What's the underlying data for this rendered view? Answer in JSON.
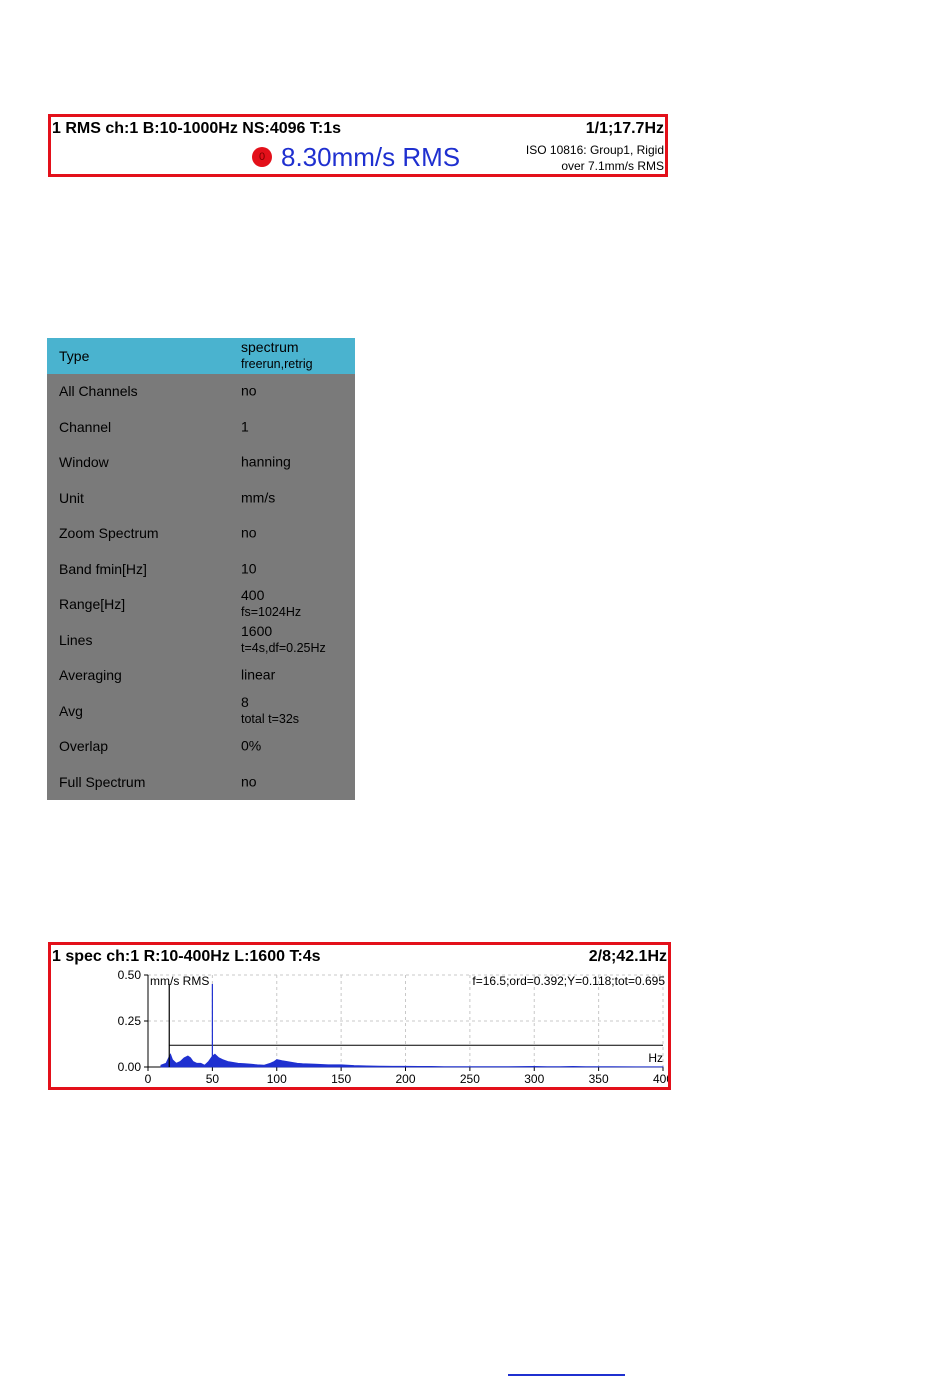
{
  "rms": {
    "title": "1 RMS ch:1 B:10-1000Hz NS:4096 T:1s",
    "position": "1/1;17.7Hz",
    "led_label": "0",
    "value": "8.30mm/s RMS",
    "iso_line1": "ISO 10816: Group1, Rigid",
    "iso_line2": "over 7.1mm/s RMS",
    "colors": {
      "border": "#e3101a",
      "value": "#1f30d0",
      "led": "#e3101a"
    }
  },
  "settings": {
    "rows": [
      {
        "label": "Type",
        "value": "spectrum",
        "sub": "freerun,retrig",
        "selected": true
      },
      {
        "label": "All Channels",
        "value": "no",
        "sub": ""
      },
      {
        "label": "Channel",
        "value": "1",
        "sub": ""
      },
      {
        "label": "Window",
        "value": "hanning",
        "sub": ""
      },
      {
        "label": "Unit",
        "value": "mm/s",
        "sub": ""
      },
      {
        "label": "Zoom Spectrum",
        "value": "no",
        "sub": ""
      },
      {
        "label": "Band fmin[Hz]",
        "value": "10",
        "sub": ""
      },
      {
        "label": "Range[Hz]",
        "value": "400",
        "sub": "fs=1024Hz"
      },
      {
        "label": "Lines",
        "value": "1600",
        "sub": "t=4s,df=0.25Hz"
      },
      {
        "label": "Averaging",
        "value": "linear",
        "sub": ""
      },
      {
        "label": "Avg",
        "value": "8",
        "sub": "total t=32s"
      },
      {
        "label": "Overlap",
        "value": "0%",
        "sub": ""
      },
      {
        "label": "Full Spectrum",
        "value": "no",
        "sub": ""
      }
    ],
    "colors": {
      "background": "#7a7a7a",
      "selected": "#4ab3cf"
    }
  },
  "spectrum": {
    "title": "1 spec ch:1 R:10-400Hz L:1600 T:4s",
    "position": "2/8;42.1Hz",
    "unit_label": "mm/s RMS",
    "x_unit": "Hz",
    "readout": "f=16.5;ord=0.392;Y=0.118;tot=0.695",
    "colors": {
      "border": "#e3101a",
      "series": "#1f30d0",
      "grid": "#c8c8c8"
    }
  },
  "chart_data": {
    "type": "area",
    "x_ticks": [
      "0",
      "50",
      "100",
      "150",
      "200",
      "250",
      "300",
      "350",
      "400"
    ],
    "y_ticks": [
      "0.50",
      "0.25",
      "0.00"
    ],
    "xlim": [
      0,
      400
    ],
    "ylim": [
      0,
      0.5
    ],
    "grid": true,
    "alarm_level": 0.118,
    "cursors": [
      {
        "x": 16.5,
        "color": "#000000"
      },
      {
        "x": 50,
        "color": "#1f30d0"
      }
    ],
    "series": [
      {
        "x": [
          10,
          14,
          16,
          17.5,
          19,
          22,
          25,
          28,
          31,
          33,
          35,
          38,
          41,
          44,
          47,
          50,
          52,
          55,
          58,
          62,
          66,
          70,
          75,
          80,
          85,
          90,
          95,
          98,
          100,
          104,
          108,
          112,
          116,
          120,
          130,
          140,
          150,
          160,
          170,
          180,
          190,
          200,
          210,
          220,
          230,
          240,
          250,
          260,
          270,
          280,
          300,
          310,
          320,
          330,
          340,
          350,
          360,
          380,
          400
        ],
        "values": [
          0.01,
          0.02,
          0.05,
          0.07,
          0.04,
          0.02,
          0.03,
          0.05,
          0.06,
          0.05,
          0.03,
          0.02,
          0.02,
          0.01,
          0.03,
          0.06,
          0.07,
          0.05,
          0.04,
          0.03,
          0.025,
          0.02,
          0.018,
          0.015,
          0.012,
          0.01,
          0.02,
          0.03,
          0.04,
          0.035,
          0.03,
          0.025,
          0.02,
          0.018,
          0.015,
          0.012,
          0.012,
          0.008,
          0.006,
          0.005,
          0.004,
          0.004,
          0.003,
          0.003,
          0.002,
          0.002,
          0.002,
          0.002,
          0.002,
          0.002,
          0.003,
          0.002,
          0.002,
          0.003,
          0.002,
          0.002,
          0.002,
          0.001,
          0.001
        ]
      }
    ]
  }
}
